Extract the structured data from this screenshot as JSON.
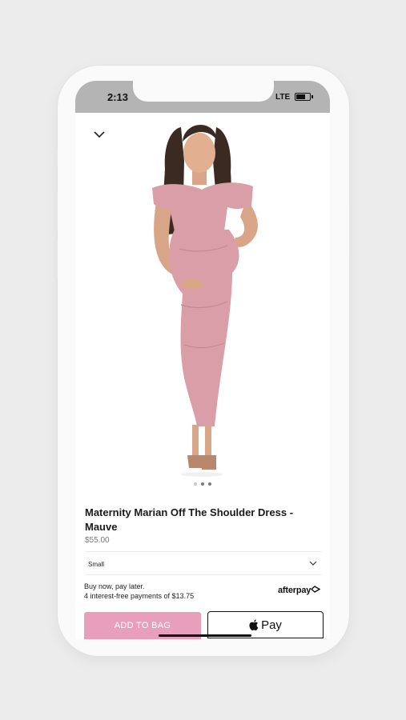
{
  "status_bar": {
    "time": "2:13",
    "carrier": "LTE"
  },
  "product": {
    "name": "Maternity Marian Off The Shoulder Dress - Mauve",
    "price": "$55.00",
    "image_alt": "Model in mauve off-the-shoulder maternity dress",
    "carousel_count": 3,
    "carousel_active": 2
  },
  "size_select": {
    "selected": "Small"
  },
  "afterpay": {
    "line1": "Buy now, pay later.",
    "line2": "4 interest-free payments of $13.75",
    "logo": "afterpay"
  },
  "actions": {
    "add_to_bag": "ADD TO BAG",
    "apple_pay": "Pay"
  },
  "colors": {
    "add_to_bag_bg": "#e79fbc",
    "dress": "#d99ea8",
    "status_bar": "#b4b4b4"
  },
  "icons": {
    "close": "chevron-down-icon",
    "size_dropdown": "chevron-down-icon",
    "apple": "apple-icon",
    "battery": "battery-icon"
  }
}
